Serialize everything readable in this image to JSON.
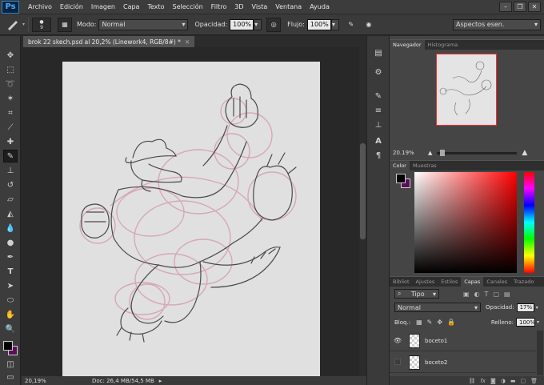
{
  "app": {
    "logo": "Ps"
  },
  "menu": [
    "Archivo",
    "Edición",
    "Imagen",
    "Capa",
    "Texto",
    "Selección",
    "Filtro",
    "3D",
    "Vista",
    "Ventana",
    "Ayuda"
  ],
  "options": {
    "brush_size": "9",
    "mode_label": "Modo:",
    "mode_value": "Normal",
    "opacity_label": "Opacidad:",
    "opacity_value": "100%",
    "flow_label": "Flujo:",
    "flow_value": "100%",
    "workspace": "Aspectos esen."
  },
  "document": {
    "tab_title": "brok 22 skech.psd al 20,2% (Linework4, RGB/8#) *",
    "status_zoom": "20,19%",
    "status_doc": "Doc: 26,4 MB/54,5 MB"
  },
  "navigator": {
    "tabs": [
      "Navegador",
      "Histograma"
    ],
    "zoom": "20.19%"
  },
  "color_panel": {
    "tabs": [
      "Color",
      "Muestras"
    ],
    "foreground": "#000000",
    "background": "#5a0f5a"
  },
  "layers_panel": {
    "tabs": [
      "Bibliot",
      "Ajustes",
      "Estilos",
      "Capas",
      "Canales",
      "Trazado"
    ],
    "filter_label": "Tipo",
    "blend_mode": "Normal",
    "opacity_label": "Opacidad:",
    "opacity_value": "17%",
    "lock_label": "Bloq.:",
    "fill_label": "Relleno:",
    "fill_value": "100%",
    "layers": [
      {
        "name": "boceto1",
        "visible": true
      },
      {
        "name": "boceto2",
        "visible": false
      }
    ]
  }
}
